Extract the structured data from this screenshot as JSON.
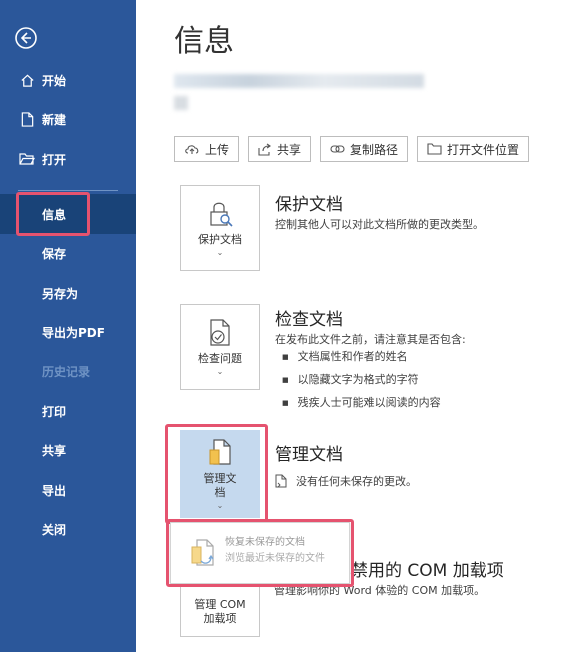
{
  "sidebar": {
    "items": [
      {
        "label": "开始",
        "icon": "home-icon"
      },
      {
        "label": "新建",
        "icon": "new-file-icon"
      },
      {
        "label": "打开",
        "icon": "open-folder-icon"
      },
      {
        "label": "信息",
        "active": true
      },
      {
        "label": "保存"
      },
      {
        "label": "另存为"
      },
      {
        "label": "导出为PDF"
      },
      {
        "label": "历史记录",
        "disabled": true
      },
      {
        "label": "打印"
      },
      {
        "label": "共享"
      },
      {
        "label": "导出"
      },
      {
        "label": "关闭"
      }
    ]
  },
  "main": {
    "title": "信息",
    "toolbar": {
      "upload": "上传",
      "share": "共享",
      "copy_path": "复制路径",
      "open_location": "打开文件位置"
    },
    "protect": {
      "button": "保护文档",
      "title": "保护文档",
      "desc": "控制其他人可以对此文档所做的更改类型。"
    },
    "inspect": {
      "button": "检查问题",
      "title": "检查文档",
      "desc": "在发布此文件之前，请注意其是否包含:",
      "bullets": [
        "文档属性和作者的姓名",
        "以隐藏文字为格式的字符",
        "残疾人士可能难以阅读的内容"
      ]
    },
    "manage": {
      "button_line1": "管理文",
      "button_line2": "档",
      "title": "管理文档",
      "desc": "没有任何未保存的更改。"
    },
    "dropdown": {
      "title": "恢复未保存的文档",
      "desc": "浏览最近未保存的文件"
    },
    "com": {
      "button_line1": "管理 COM",
      "button_line2": "加载项",
      "title": "已禁用的 COM 加载项",
      "desc": "管理影响你的 Word 体验的 COM 加载项。"
    }
  },
  "colors": {
    "sidebar_bg": "#2b579a",
    "sidebar_active": "#194378",
    "highlight": "#e5536f",
    "selected_card": "#c5d9ee"
  }
}
